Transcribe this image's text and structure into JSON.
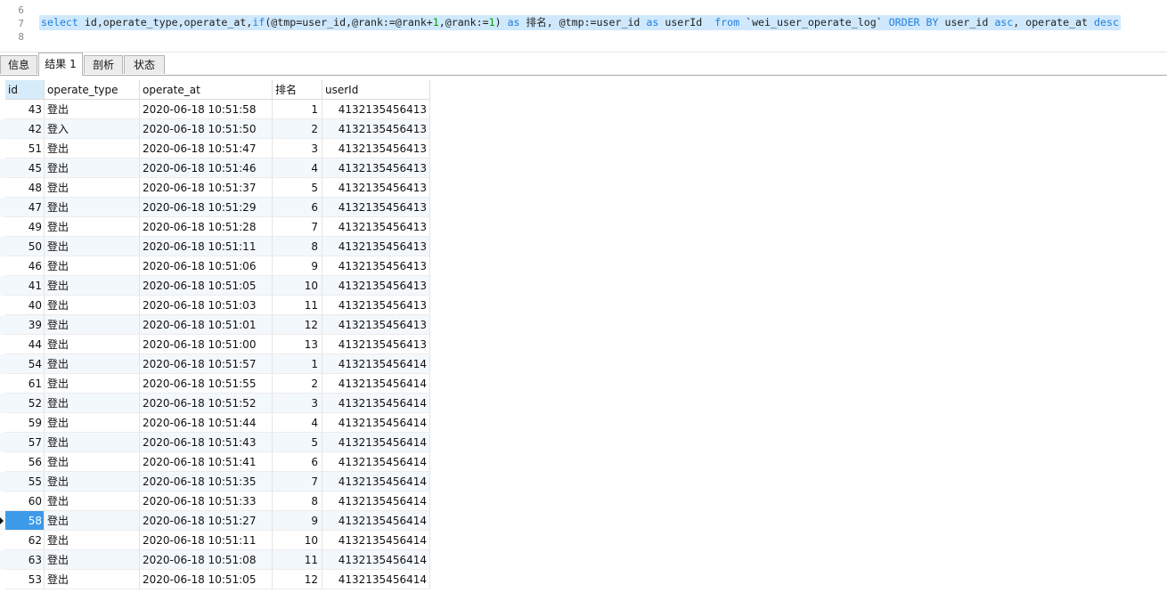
{
  "editor": {
    "line_numbers": [
      "6",
      "7",
      "8"
    ],
    "sql": [
      {
        "t": "select",
        "c": "kw"
      },
      {
        "t": " id,operate_type,operate_at,",
        "c": "plain"
      },
      {
        "t": "if",
        "c": "fn"
      },
      {
        "t": "(@tmp=user_id,@rank:=@rank+",
        "c": "plain"
      },
      {
        "t": "1",
        "c": "num"
      },
      {
        "t": ",@rank:=",
        "c": "plain"
      },
      {
        "t": "1",
        "c": "num"
      },
      {
        "t": ") ",
        "c": "plain"
      },
      {
        "t": "as",
        "c": "kw"
      },
      {
        "t": " 排名, @tmp:=user_id ",
        "c": "plain"
      },
      {
        "t": "as",
        "c": "kw"
      },
      {
        "t": " userId  ",
        "c": "plain"
      },
      {
        "t": "from",
        "c": "kw"
      },
      {
        "t": " `wei_user_operate_log` ",
        "c": "plain"
      },
      {
        "t": "ORDER BY",
        "c": "kw"
      },
      {
        "t": " user_id ",
        "c": "plain"
      },
      {
        "t": "asc",
        "c": "kw"
      },
      {
        "t": ", operate_at ",
        "c": "plain"
      },
      {
        "t": "desc",
        "c": "kw"
      }
    ]
  },
  "tabs": [
    {
      "label": "信息",
      "active": false
    },
    {
      "label": "结果 1",
      "active": true
    },
    {
      "label": "剖析",
      "active": false
    },
    {
      "label": "状态",
      "active": false
    }
  ],
  "grid": {
    "columns": [
      "id",
      "operate_type",
      "operate_at",
      "排名",
      "userId"
    ],
    "selected_column": 0,
    "focus_row": 21,
    "rows": [
      [
        "43",
        "登出",
        "2020-06-18 10:51:58",
        "1",
        "4132135456413"
      ],
      [
        "42",
        "登入",
        "2020-06-18 10:51:50",
        "2",
        "4132135456413"
      ],
      [
        "51",
        "登出",
        "2020-06-18 10:51:47",
        "3",
        "4132135456413"
      ],
      [
        "45",
        "登出",
        "2020-06-18 10:51:46",
        "4",
        "4132135456413"
      ],
      [
        "48",
        "登出",
        "2020-06-18 10:51:37",
        "5",
        "4132135456413"
      ],
      [
        "47",
        "登出",
        "2020-06-18 10:51:29",
        "6",
        "4132135456413"
      ],
      [
        "49",
        "登出",
        "2020-06-18 10:51:28",
        "7",
        "4132135456413"
      ],
      [
        "50",
        "登出",
        "2020-06-18 10:51:11",
        "8",
        "4132135456413"
      ],
      [
        "46",
        "登出",
        "2020-06-18 10:51:06",
        "9",
        "4132135456413"
      ],
      [
        "41",
        "登出",
        "2020-06-18 10:51:05",
        "10",
        "4132135456413"
      ],
      [
        "40",
        "登出",
        "2020-06-18 10:51:03",
        "11",
        "4132135456413"
      ],
      [
        "39",
        "登出",
        "2020-06-18 10:51:01",
        "12",
        "4132135456413"
      ],
      [
        "44",
        "登出",
        "2020-06-18 10:51:00",
        "13",
        "4132135456413"
      ],
      [
        "54",
        "登出",
        "2020-06-18 10:51:57",
        "1",
        "4132135456414"
      ],
      [
        "61",
        "登出",
        "2020-06-18 10:51:55",
        "2",
        "4132135456414"
      ],
      [
        "52",
        "登出",
        "2020-06-18 10:51:52",
        "3",
        "4132135456414"
      ],
      [
        "59",
        "登出",
        "2020-06-18 10:51:44",
        "4",
        "4132135456414"
      ],
      [
        "57",
        "登出",
        "2020-06-18 10:51:43",
        "5",
        "4132135456414"
      ],
      [
        "56",
        "登出",
        "2020-06-18 10:51:41",
        "6",
        "4132135456414"
      ],
      [
        "55",
        "登出",
        "2020-06-18 10:51:35",
        "7",
        "4132135456414"
      ],
      [
        "60",
        "登出",
        "2020-06-18 10:51:33",
        "8",
        "4132135456414"
      ],
      [
        "58",
        "登出",
        "2020-06-18 10:51:27",
        "9",
        "4132135456414"
      ],
      [
        "62",
        "登出",
        "2020-06-18 10:51:11",
        "10",
        "4132135456414"
      ],
      [
        "63",
        "登出",
        "2020-06-18 10:51:08",
        "11",
        "4132135456414"
      ],
      [
        "53",
        "登出",
        "2020-06-18 10:51:05",
        "12",
        "4132135456414"
      ]
    ]
  }
}
